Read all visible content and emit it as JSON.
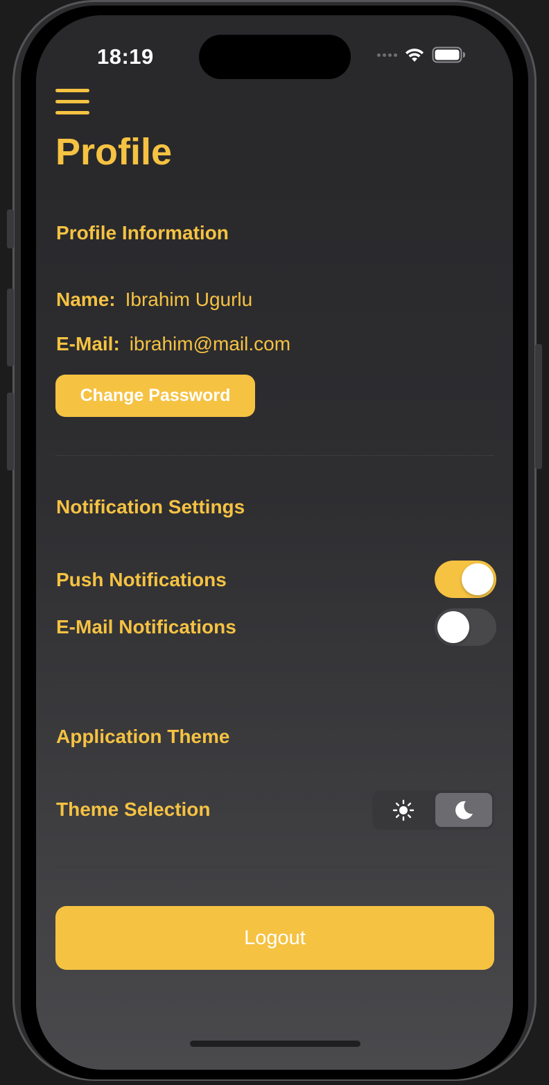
{
  "status_bar": {
    "time": "18:19",
    "icons": [
      "signal-dots-icon",
      "wifi-icon",
      "battery-icon"
    ]
  },
  "header": {
    "menu_icon": "hamburger-menu-icon",
    "title": "Profile"
  },
  "profile_section": {
    "title": "Profile Information",
    "name_label": "Name:",
    "name_value": "Ibrahim Ugurlu",
    "email_label": "E-Mail:",
    "email_value": "ibrahim@mail.com",
    "change_password_label": "Change Password"
  },
  "notification_section": {
    "title": "Notification Settings",
    "push_label": "Push Notifications",
    "push_enabled": true,
    "email_label": "E-Mail Notifications",
    "email_enabled": false
  },
  "theme_section": {
    "title": "Application Theme",
    "selection_label": "Theme Selection",
    "options": [
      "sun-icon",
      "moon-icon"
    ],
    "selected": "moon-icon"
  },
  "logout_label": "Logout",
  "colors": {
    "accent": "#f5c242",
    "background": "#29292b",
    "toggle_off": "#48484b"
  }
}
